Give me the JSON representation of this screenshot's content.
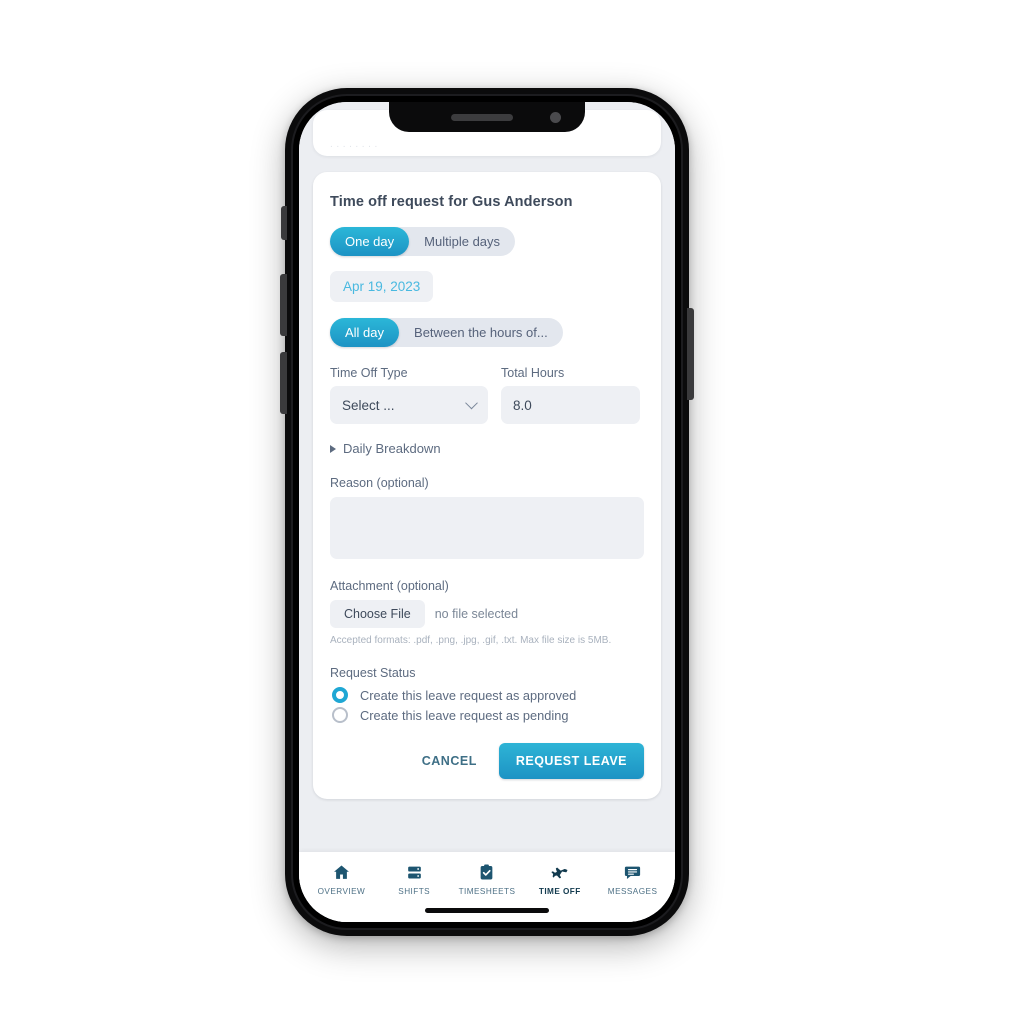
{
  "card": {
    "title": "Time off request for Gus Anderson",
    "duration_toggle": {
      "options": [
        "One day",
        "Multiple days"
      ],
      "selected": "One day"
    },
    "date_chip": "Apr 19, 2023",
    "hours_toggle": {
      "options": [
        "All day",
        "Between the hours of..."
      ],
      "selected": "All day"
    },
    "time_off_type": {
      "label": "Time Off Type",
      "value": "Select ..."
    },
    "total_hours": {
      "label": "Total Hours",
      "value": "8.0"
    },
    "daily_breakdown_label": "Daily Breakdown",
    "reason": {
      "label": "Reason (optional)",
      "value": ""
    },
    "attachment": {
      "label": "Attachment (optional)",
      "choose_file_label": "Choose File",
      "file_status": "no file selected",
      "hint": "Accepted formats: .pdf, .png, .jpg, .gif, .txt. Max file size is 5MB."
    },
    "request_status": {
      "label": "Request Status",
      "options": [
        {
          "label": "Create this leave request as approved",
          "selected": true
        },
        {
          "label": "Create this leave request as pending",
          "selected": false
        }
      ]
    },
    "actions": {
      "cancel_label": "CANCEL",
      "submit_label": "REQUEST LEAVE"
    }
  },
  "tabbar": {
    "items": [
      {
        "label": "OVERVIEW",
        "icon": "home-icon",
        "active": false
      },
      {
        "label": "SHIFTS",
        "icon": "shifts-icon",
        "active": false
      },
      {
        "label": "TIMESHEETS",
        "icon": "clipboard-check-icon",
        "active": false
      },
      {
        "label": "TIME OFF",
        "icon": "airplane-icon",
        "active": true
      },
      {
        "label": "MESSAGES",
        "icon": "chat-icon",
        "active": false
      }
    ]
  },
  "colors": {
    "accent": "#1fa7d4",
    "accent_dark": "#1d93c4",
    "tab_active": "#123a4e",
    "tab_inactive": "#4e7186",
    "text": "#3e4a5b",
    "field_bg": "#eef0f4"
  }
}
